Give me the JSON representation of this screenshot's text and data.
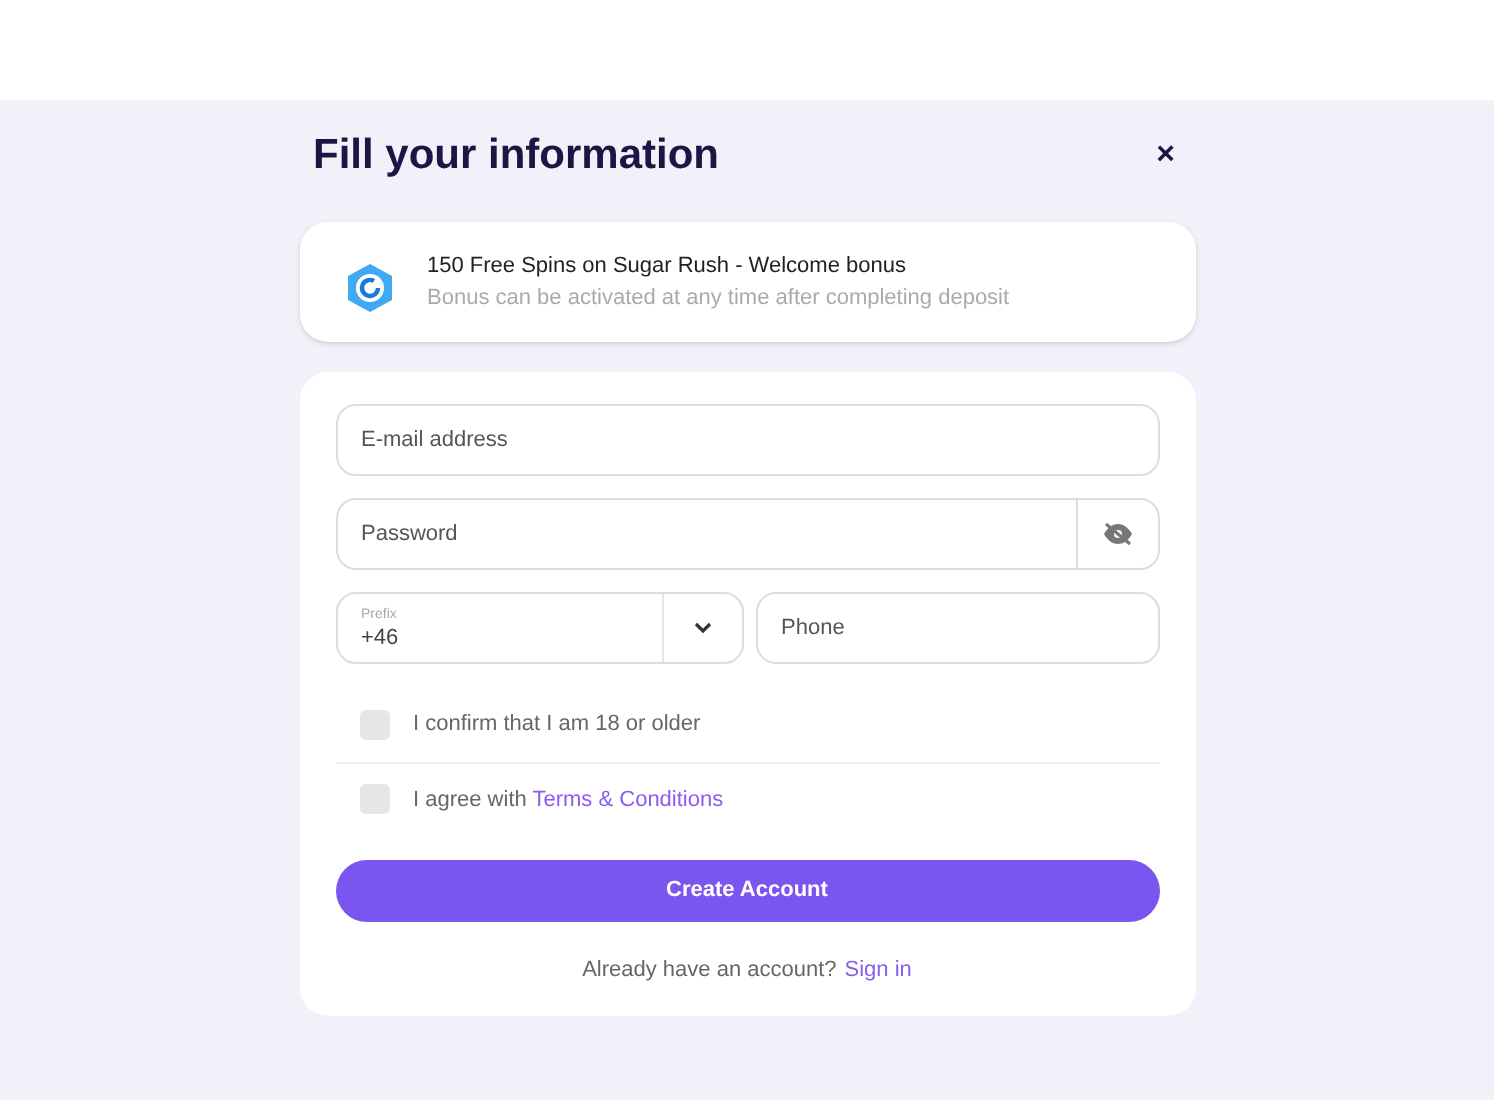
{
  "title": "Fill your information",
  "close": "×",
  "bonus": {
    "title": "150 Free Spins on Sugar Rush - Welcome bonus",
    "description": "Bonus can be activated at any time after completing deposit"
  },
  "form": {
    "email": {
      "placeholder": "E-mail address"
    },
    "password": {
      "placeholder": "Password"
    },
    "prefix": {
      "label": "Prefix",
      "value": "+46"
    },
    "phone": {
      "placeholder": "Phone"
    },
    "checkboxes": [
      {
        "text": "I confirm that I am 18 or older",
        "checked": false
      },
      {
        "text": "I agree with ",
        "link": "Terms & Conditions",
        "checked": false
      }
    ],
    "submit": "Create Account",
    "footer": {
      "text": "Already have an account?",
      "link": "Sign in"
    }
  }
}
